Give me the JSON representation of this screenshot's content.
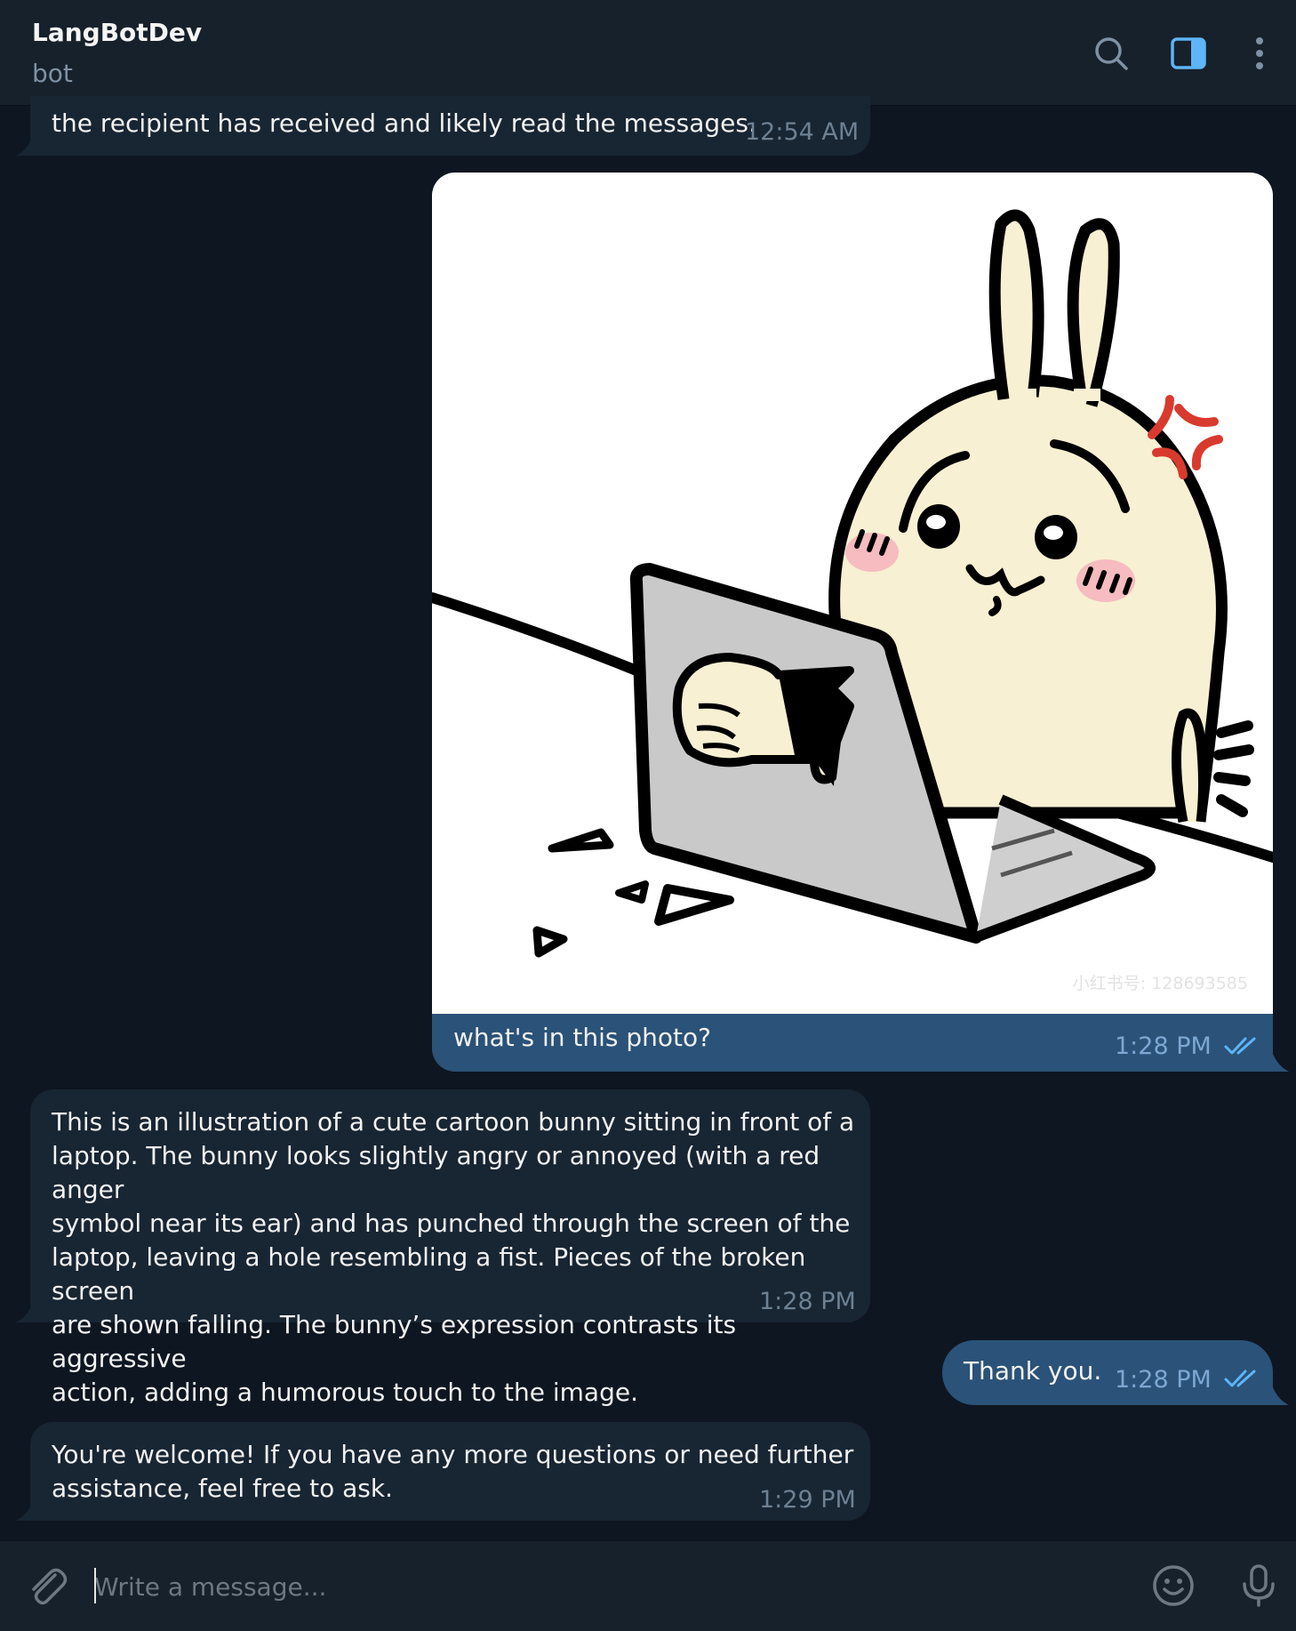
{
  "header": {
    "title": "LangBotDev",
    "subtitle": "bot",
    "icons": [
      "search-icon",
      "sidebar-toggle-icon",
      "more-vertical-icon"
    ]
  },
  "colors": {
    "background": "#0e1621",
    "incoming_bubble": "#182533",
    "outgoing_bubble": "#2b5278",
    "header": "#17212b",
    "accent": "#5eb5f7"
  },
  "messages": [
    {
      "direction": "incoming",
      "text": "the recipient has received and likely read the messages.",
      "time": "12:54 AM"
    },
    {
      "direction": "outgoing",
      "image": "cartoon-bunny-laptop-photo",
      "image_watermark": "小红书号: 128693585",
      "caption": "what's in this photo?",
      "time": "1:28 PM",
      "status": "read"
    },
    {
      "direction": "incoming",
      "lines": [
        "This is an illustration of a cute cartoon bunny sitting in front of a",
        "laptop. The bunny looks slightly angry or annoyed (with a red anger",
        "symbol near its ear) and has punched through the screen of the",
        "laptop, leaving a hole resembling a fist. Pieces of the broken screen",
        "are shown falling. The bunny’s expression contrasts its aggressive",
        "action, adding a humorous touch to the image."
      ],
      "time": "1:28 PM"
    },
    {
      "direction": "outgoing",
      "text": "Thank you.",
      "time": "1:28 PM",
      "status": "read"
    },
    {
      "direction": "incoming",
      "lines": [
        "You're welcome! If you have any more questions or need further",
        "assistance, feel free to ask."
      ],
      "time": "1:29 PM"
    }
  ],
  "composer": {
    "placeholder": "Write a message...",
    "icons": [
      "paperclip-icon",
      "emoji-icon",
      "microphone-icon"
    ]
  }
}
